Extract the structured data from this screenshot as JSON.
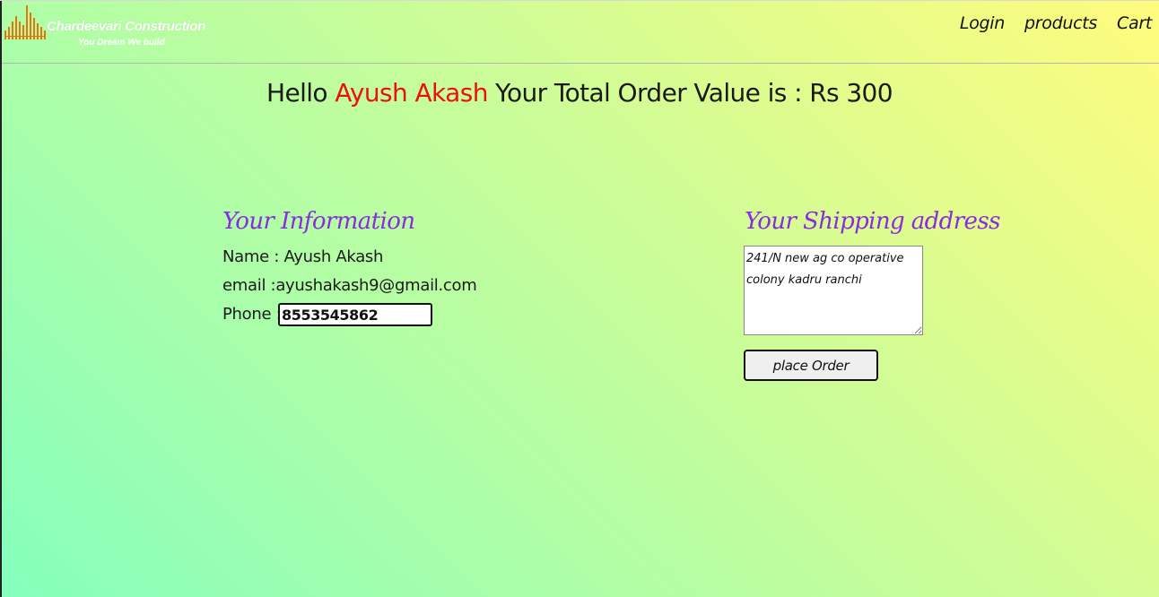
{
  "header": {
    "logo_title": "Chardeevari Construction",
    "logo_tagline": "You Dream We build",
    "nav": [
      {
        "label": "Login"
      },
      {
        "label": "products"
      },
      {
        "label": "Cart"
      }
    ]
  },
  "greeting": {
    "prefix": "Hello",
    "user_name": "Ayush Akash",
    "suffix": "Your Total Order Value is : Rs 300"
  },
  "info": {
    "title": "Your Information",
    "name_line": "Name : Ayush Akash",
    "email_line": "email :ayushakash9@gmail.com",
    "phone_label": "Phone :",
    "phone_value": "8553545862"
  },
  "shipping": {
    "title": "Your Shipping address",
    "address": "241/N new ag co operative colony kadru ranchi",
    "button_label": "place Order"
  },
  "colors": {
    "bg_start": "#85ffbd",
    "bg_end": "#fffb7d",
    "highlight_name": "#ee0f0f",
    "section_title": "#8a2be2",
    "logo_bars": "#e8730c"
  }
}
